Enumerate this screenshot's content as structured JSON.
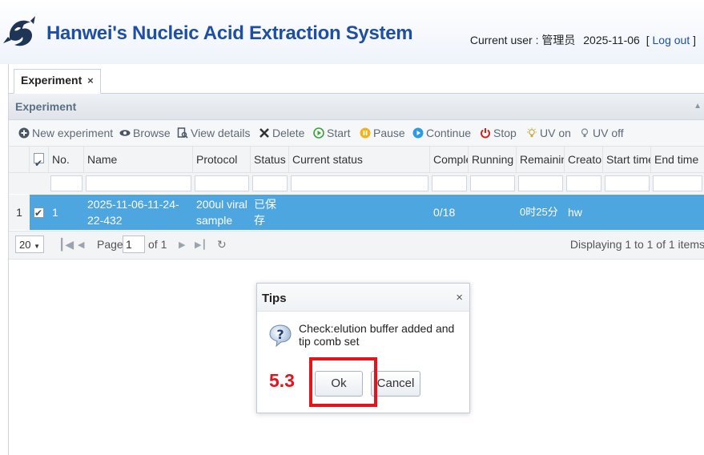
{
  "header": {
    "app_title": "Hanwei's Nucleic Acid Extraction System",
    "user_label": "Current user : 管理员",
    "date": "2025-11-06",
    "bracket_open": "[",
    "logout_label": "Log out",
    "bracket_close": "]",
    "logo_icon": "fish-logo-icon"
  },
  "tabs": [
    {
      "label": "Experiment",
      "close": "×"
    }
  ],
  "panel": {
    "title": "Experiment"
  },
  "toolbar": {
    "new_experiment": "New experiment",
    "browse": "Browse",
    "view_details": "View details",
    "delete": "Delete",
    "start": "Start",
    "pause": "Pause",
    "continue": "Continue",
    "stop": "Stop",
    "uv_on": "UV on",
    "uv_off": "UV off"
  },
  "grid": {
    "columns": {
      "no": "No.",
      "name": "Name",
      "protocol": "Protocol",
      "status": "Status",
      "current_status": "Current status",
      "complete": "Comple",
      "running": "Running t",
      "remaining": "Remainin",
      "creator": "Creator",
      "start_time": "Start time",
      "end_time": "End time"
    },
    "rows": [
      {
        "row_number": "1",
        "checked": true,
        "no": "1",
        "name": "2025-11-06-11-24-22-432",
        "protocol": "200ul viral sample",
        "status": "已保存",
        "current_status": "",
        "complete": "0/18",
        "running": "",
        "remaining": "0时25分",
        "creator": "hw",
        "start_time": "",
        "end_time": ""
      }
    ]
  },
  "pager": {
    "page_size": "20",
    "page_label": "Page",
    "page_value": "1",
    "of_label": "of 1",
    "display_info": "Displaying 1 to 1 of 1 items"
  },
  "dialog": {
    "title": "Tips",
    "close": "×",
    "message": "Check:elution buffer added and tip comb set",
    "ok_label": "Ok",
    "cancel_label": "Cancel"
  },
  "annotation": {
    "step": "5.3",
    "color": "#e8121a"
  },
  "colors": {
    "title_blue": "#1f4fa3",
    "selected_row": "#4ea6e0",
    "link": "#1a4fb3"
  }
}
